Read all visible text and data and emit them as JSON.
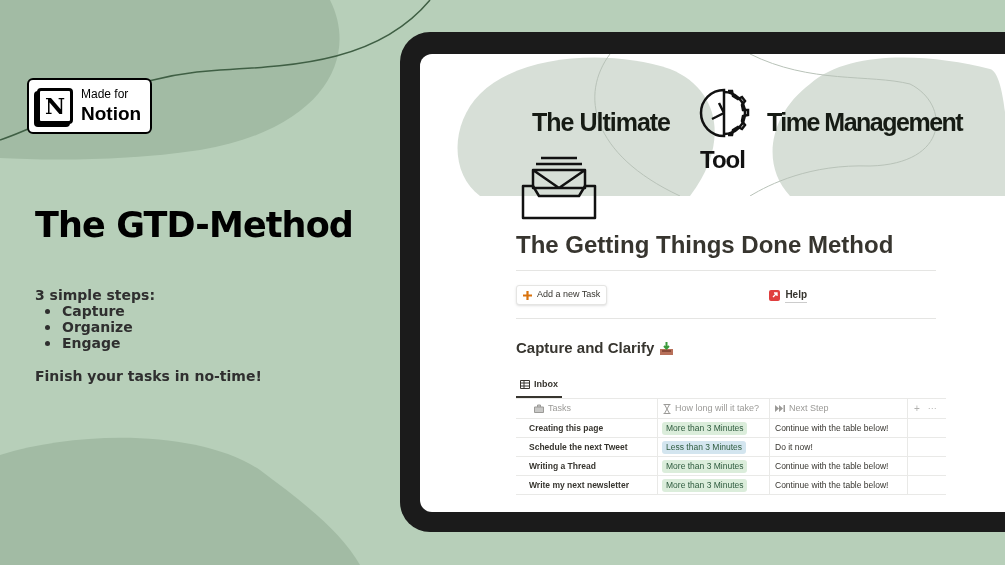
{
  "badge": {
    "logo_letter": "N",
    "line1": "Made for",
    "line2": "Notion"
  },
  "headline": "The GTD-Method",
  "steps_title": "3 simple steps:",
  "steps": [
    "Capture",
    "Organize",
    "Engage"
  ],
  "tagline": "Finish your tasks in no-time!",
  "tablet": {
    "cover": {
      "left_text": "The Ultimate",
      "right_text": "Time Management",
      "under_icon": "Tool"
    },
    "page_title": "The Getting Things Done Method",
    "add_button": "Add a new Task",
    "help_link": "Help",
    "section_title": "Capture and Clarify",
    "view_tabs": [
      {
        "label": "Inbox",
        "selected": true
      }
    ],
    "table": {
      "columns": [
        "Tasks",
        "How long will it take?",
        "Next Step"
      ],
      "add_column": "+",
      "more": "···",
      "rows": [
        {
          "task": "Creating this page",
          "duration": {
            "text": "More than 3 Minutes",
            "color": "#dbeddb"
          },
          "next_step": "Continue with the table below!"
        },
        {
          "task": "Schedule the next Tweet",
          "duration": {
            "text": "Less than 3 Minutes",
            "color": "#d3e5ef"
          },
          "next_step": "Do it now!"
        },
        {
          "task": "Writing a Thread",
          "duration": {
            "text": "More than 3 Minutes",
            "color": "#dbeddb"
          },
          "next_step": "Continue with the table below!"
        },
        {
          "task": "Write my next newsletter",
          "duration": {
            "text": "More than 3 Minutes",
            "color": "#dbeddb"
          },
          "next_step": "Continue with the table below!"
        }
      ]
    }
  }
}
